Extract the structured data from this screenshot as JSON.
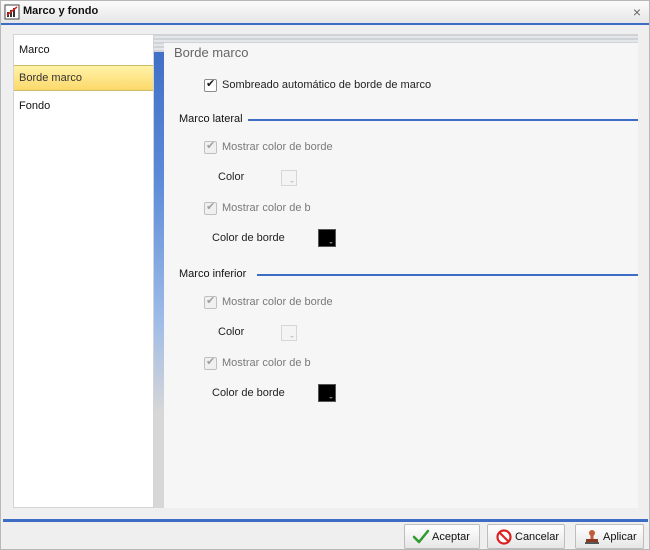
{
  "window": {
    "title": "Marco y fondo",
    "close_symbol": "×"
  },
  "sidebar": {
    "items": [
      {
        "label": "Marco",
        "selected": false
      },
      {
        "label": "Borde marco",
        "selected": true
      },
      {
        "label": "Fondo",
        "selected": false
      }
    ]
  },
  "panel": {
    "title": "Borde marco",
    "auto_shadow": {
      "label": "Sombreado automático de borde de marco",
      "checked": true
    },
    "sections": [
      {
        "title": "Marco lateral",
        "show_color1": {
          "label": "Mostrar color de borde",
          "checked": true,
          "disabled": true
        },
        "color_label": "Color",
        "color_value": "",
        "show_color2": {
          "label": "Mostrar color de b",
          "checked": true,
          "disabled": true
        },
        "border_color_label": "Color de borde",
        "border_color_value": "#000000"
      },
      {
        "title": "Marco inferior",
        "show_color1": {
          "label": "Mostrar color de borde",
          "checked": true,
          "disabled": true
        },
        "color_label": "Color",
        "color_value": "",
        "show_color2": {
          "label": "Mostrar color de b",
          "checked": true,
          "disabled": true
        },
        "border_color_label": "Color de borde",
        "border_color_value": "#000000"
      }
    ]
  },
  "footer": {
    "ok_label": "Aceptar",
    "cancel_label": "Cancelar",
    "apply_label": "Aplicar"
  },
  "colors": {
    "accent": "#3c6cc4",
    "selection": "#fcd86a"
  },
  "icons": {
    "app": "chart-frame-icon",
    "ok": "checkmark-icon",
    "cancel": "prohibited-icon",
    "apply": "stamp-icon"
  }
}
